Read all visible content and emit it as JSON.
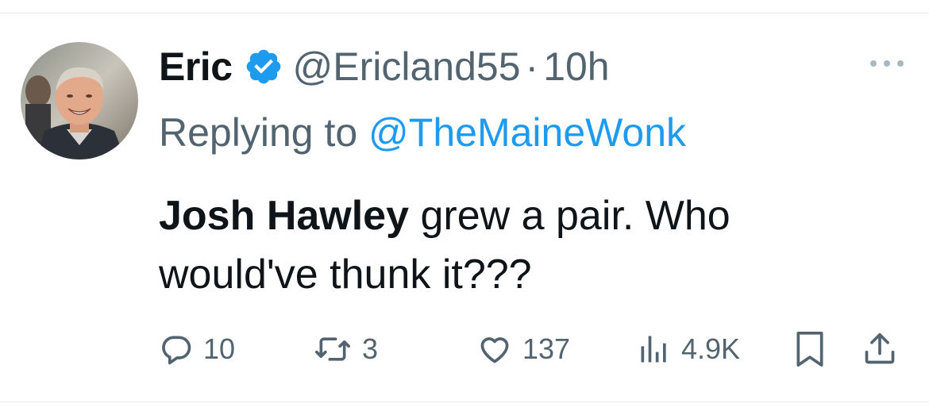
{
  "author": {
    "name": "Eric",
    "verified": true,
    "handle": "@Ericland55",
    "separator": "·",
    "time": "10h"
  },
  "reply": {
    "prefix": "Replying to ",
    "mention": "@TheMaineWonk"
  },
  "tweet": {
    "bold_text": "Josh Hawley",
    "text": " grew a pair. Who would've thunk it???"
  },
  "metrics": {
    "replies": "10",
    "retweets": "3",
    "likes": "137",
    "views": "4.9K"
  },
  "icons": {
    "verified": "verified-badge-icon",
    "more": "more-options-icon",
    "reply": "reply-icon",
    "retweet": "retweet-icon",
    "like": "heart-icon",
    "views": "views-chart-icon",
    "bookmark": "bookmark-icon",
    "share": "share-icon"
  },
  "colors": {
    "text": "#0f1419",
    "secondary": "#536471",
    "accent": "#1d9bf0"
  }
}
